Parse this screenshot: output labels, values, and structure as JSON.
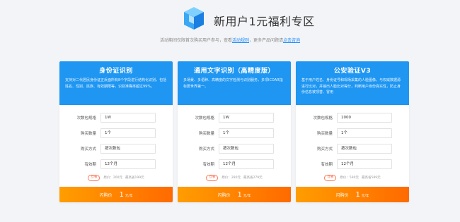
{
  "header": {
    "title": "新用户1元福利专区",
    "notice_prefix": "活动期间仅限首次购买用户参与，查看",
    "rules_link": "活动规则",
    "notice_mid": "，更多产品问题请",
    "consult_link": "点击咨询"
  },
  "colors": {
    "card_header": "#1e96f2",
    "footer_gradient_start": "#ff9d00",
    "footer_gradient_end": "#ff6a00",
    "badge": "#ff5a36",
    "link": "#1a8cff"
  },
  "cards": [
    {
      "title": "身份证识别",
      "desc": "支持对二代居民身份证正反面所有8个字段进行结构化识别，包括姓名、性别、民族、有效期限等，识别准确率超过99%。",
      "rows": [
        {
          "label": "次数包规格",
          "value": "1W"
        },
        {
          "label": "购买数量",
          "value": "1个"
        },
        {
          "label": "购买方式",
          "value": "按次数包"
        },
        {
          "label": "有效期",
          "value": "12个月"
        }
      ],
      "badge": "立省",
      "original_price": "原价：200元",
      "saving": "最高省199元",
      "footer_label": "闪购价",
      "footer_price": "1",
      "footer_unit": "元/年"
    },
    {
      "title": "通用文字识别（高精度版）",
      "desc": "多场景、多语种、高精度的文字检测与识别服务，多项ICDAR指标居世界第一。",
      "rows": [
        {
          "label": "次数包规格",
          "value": "1W"
        },
        {
          "label": "购买数量",
          "value": "1个"
        },
        {
          "label": "购买方式",
          "value": "按次数包"
        },
        {
          "label": "有效期",
          "value": "12个月"
        }
      ],
      "badge": "立省",
      "original_price": "原价：280元",
      "saving": "最高省279元",
      "footer_label": "闪购价",
      "footer_price": "1",
      "footer_unit": "元/年"
    },
    {
      "title": "公安验证V3",
      "desc": "基于用户姓名、身份证号和现场采集的人脸图像，与权威数据源进行比对，并输出人脸比对得分，判断用户身份真实性，防止身份信息被顶替、冒用",
      "rows": [
        {
          "label": "次数包规格",
          "value": "1000"
        },
        {
          "label": "购买数量",
          "value": "1个"
        },
        {
          "label": "购买方式",
          "value": "按次数包"
        },
        {
          "label": "有效期",
          "value": "12个月"
        }
      ],
      "badge": "立省",
      "original_price": "原价：590元",
      "saving": "最高省589元",
      "footer_label": "闪购价",
      "footer_price": "1",
      "footer_unit": "元/年"
    }
  ]
}
